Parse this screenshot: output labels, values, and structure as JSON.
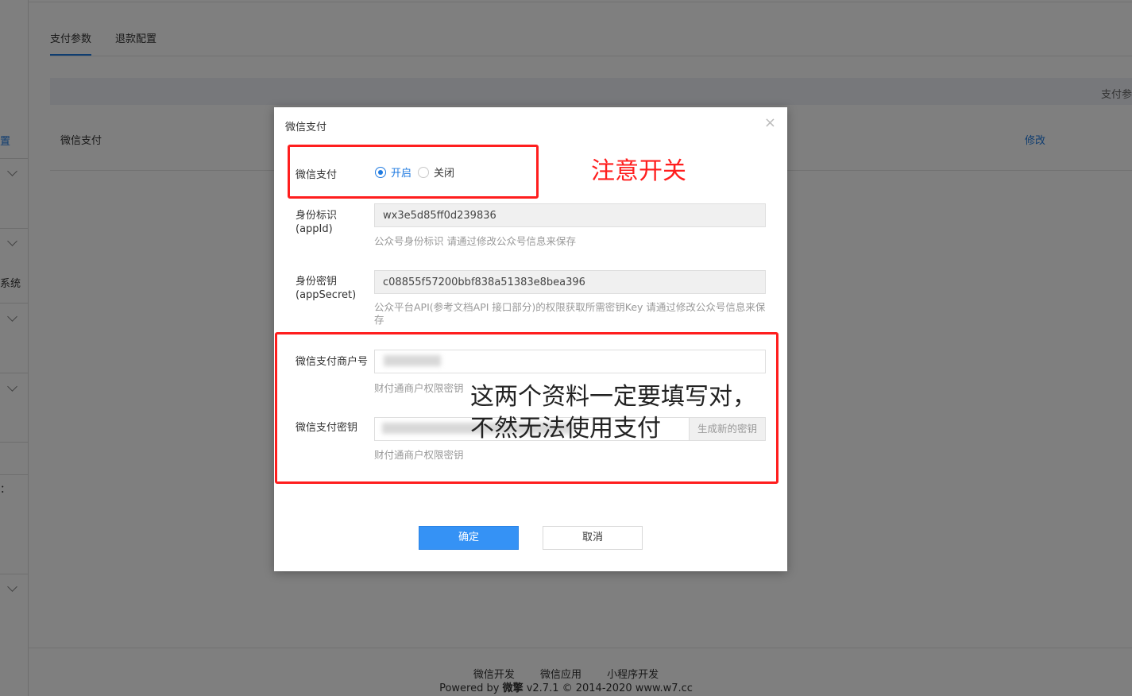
{
  "left_rail": {
    "text_a": "置",
    "text_b": "系统",
    "text_c": "："
  },
  "tabs": [
    {
      "label": "支付参数"
    },
    {
      "label": "退款配置"
    }
  ],
  "table": {
    "header_text": "支付参",
    "row_label": "微信支付",
    "row_edit": "修改"
  },
  "modal": {
    "title": "微信支付",
    "close": "×",
    "switch_label": "微信支付",
    "radio_on": "开启",
    "radio_off": "关闭",
    "appid_label_1": "身份标识",
    "appid_label_2": "(appId)",
    "appid_value": "wx3e5d85ff0d239836",
    "appid_help": "公众号身份标识 请通过修改公众号信息来保存",
    "secret_label_1": "身份密钥",
    "secret_label_2": "(appSecret)",
    "secret_value": "c08855f57200bbf838a51383e8bea396",
    "secret_help": "公众平台API(参考文档API 接口部分)的权限获取所需密钥Key 请通过修改公众号信息来保存",
    "mch_label": "微信支付商户号",
    "mch_help": "财付通商户权限密钥",
    "key_label": "微信支付密钥",
    "key_help": "财付通商户权限密钥",
    "gen_button": "生成新的密钥",
    "ok": "确定",
    "cancel": "取消"
  },
  "annotations": {
    "switch_note": "注意开关",
    "fill_note_1": "这两个资料一定要填写对，",
    "fill_note_2": "不然无法使用支付"
  },
  "footer": {
    "links": [
      "微信开发",
      "微信应用",
      "小程序开发"
    ],
    "powered_prefix": "Powered by ",
    "brand": "微擎",
    "powered_suffix": " v2.7.1 © 2014-2020 www.w7.cc"
  },
  "colors": {
    "accent": "#1f7ae0",
    "primary_button": "#3592f5",
    "annotation": "#ff1e1e"
  }
}
